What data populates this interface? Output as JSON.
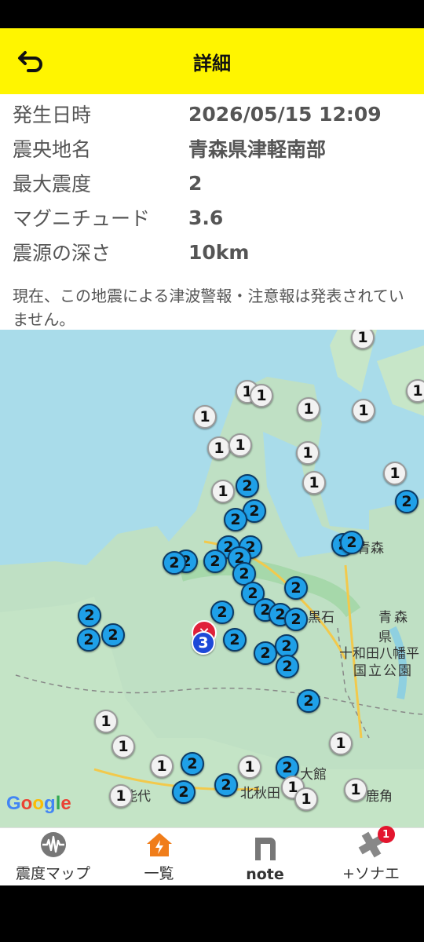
{
  "header": {
    "title": "詳細",
    "back_icon": "undo-arrow-icon"
  },
  "details": {
    "rows": [
      {
        "key": "発生日時",
        "value": "2026/05/15 12:09"
      },
      {
        "key": "震央地名",
        "value": "青森県津軽南部"
      },
      {
        "key": "最大震度",
        "value": "2"
      },
      {
        "key": "マグニチュード",
        "value": "3.6"
      },
      {
        "key": "震源の深さ",
        "value": "10km"
      }
    ],
    "notice": "現在、この地震による津波警報・注意報は発表されていません。"
  },
  "map": {
    "epicenter_icon": "epicenter-x-icon",
    "places": [
      "青森",
      "青森県",
      "黒石",
      "十和田八幡平",
      "国立公園",
      "能代",
      "北秋田",
      "大館",
      "鹿角"
    ],
    "intensity_markers": [
      "1",
      "1",
      "1",
      "1",
      "1",
      "1",
      "1",
      "1",
      "1",
      "1",
      "1",
      "1",
      "1",
      "2",
      "2",
      "2",
      "2",
      "2",
      "2",
      "2",
      "2",
      "2",
      "2",
      "2",
      "2",
      "2",
      "2",
      "2",
      "2",
      "2",
      "2",
      "2",
      "2",
      "2",
      "2",
      "2",
      "2",
      "2",
      "2",
      "3",
      "1",
      "1",
      "1",
      "2",
      "1",
      "2",
      "2",
      "1",
      "2",
      "1",
      "1",
      "1",
      "2",
      "1"
    ],
    "attribution": [
      "G",
      "o",
      "o",
      "g",
      "l",
      "e"
    ]
  },
  "nav": [
    {
      "label": "震度マップ",
      "icon": "seismograph-icon"
    },
    {
      "label": "一覧",
      "icon": "home-alert-icon"
    },
    {
      "label": "note",
      "icon": "note-n-icon"
    },
    {
      "label": "+ソナエ",
      "icon": "plus-cross-icon",
      "badge": "1"
    }
  ],
  "colors": {
    "header": "#fff500",
    "intensity1": "#f2f2f2",
    "intensity2": "#1fa0e8",
    "intensity3": "#1d49d8",
    "epicenter": "#e0203a",
    "active_nav": "#f07d1a"
  }
}
